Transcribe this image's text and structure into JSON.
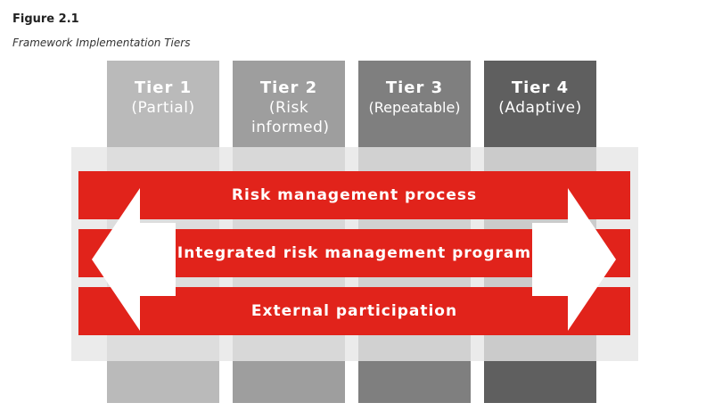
{
  "figure": {
    "label": "Figure 2.1",
    "title": "Framework Implementation Tiers"
  },
  "tiers": [
    {
      "name": "Tier 1",
      "subtitle": "(Partial)",
      "color": "#bababa"
    },
    {
      "name": "Tier 2",
      "subtitle": "(Risk informed)",
      "color": "#9e9e9e"
    },
    {
      "name": "Tier 3",
      "subtitle": "(Repeatable)",
      "color": "#7f7f7f"
    },
    {
      "name": "Tier 4",
      "subtitle": "(Adaptive)",
      "color": "#5f5f5f"
    }
  ],
  "bands": [
    {
      "label": "Risk management process"
    },
    {
      "label": "Integrated risk management program"
    },
    {
      "label": "External participation"
    }
  ],
  "colors": {
    "band": "#e1231b",
    "arrow": "#ffffff"
  },
  "arrows": [
    "double-arrow-left-icon",
    "double-arrow-right-icon"
  ]
}
